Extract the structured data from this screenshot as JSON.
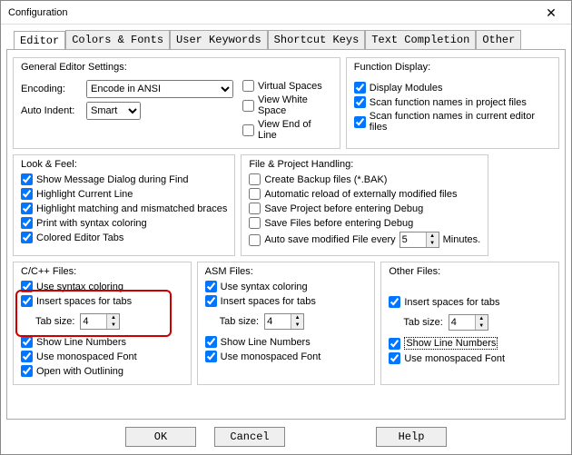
{
  "window": {
    "title": "Configuration"
  },
  "tabs": {
    "editor": "Editor",
    "colors": "Colors & Fonts",
    "keywords": "User Keywords",
    "shortcuts": "Shortcut Keys",
    "completion": "Text Completion",
    "other": "Other"
  },
  "general": {
    "title": "General Editor Settings:",
    "encoding_label": "Encoding:",
    "encoding_value": "Encode in ANSI",
    "autoindent_label": "Auto Indent:",
    "autoindent_value": "Smart",
    "virtual_spaces": "Virtual Spaces",
    "view_whitespace": "View White Space",
    "view_eol": "View End of Line"
  },
  "funcdisp": {
    "title": "Function Display:",
    "display_modules": "Display Modules",
    "scan_project": "Scan function names in project files",
    "scan_current": "Scan function names in current editor files"
  },
  "lookfeel": {
    "title": "Look & Feel:",
    "msg_dialog": "Show Message Dialog during Find",
    "hl_current": "Highlight Current Line",
    "hl_braces": "Highlight matching and mismatched braces",
    "print_syntax": "Print with syntax coloring",
    "colored_tabs": "Colored Editor Tabs"
  },
  "filehandling": {
    "title": "File & Project Handling:",
    "backup": "Create Backup files (*.BAK)",
    "autoreload": "Automatic reload of externally modified files",
    "save_proj_debug": "Save Project before entering Debug",
    "save_files_debug": "Save Files before entering Debug",
    "autosave": "Auto save modified File every",
    "autosave_minutes": "5",
    "minutes_label": "Minutes."
  },
  "cfiles": {
    "title": "C/C++ Files:",
    "syntax": "Use syntax coloring",
    "insert_spaces": "Insert spaces for tabs",
    "tabsize_label": "Tab size:",
    "tabsize_value": "4",
    "line_numbers": "Show Line Numbers",
    "mono_font": "Use monospaced Font",
    "outlining": "Open with Outlining"
  },
  "asmfiles": {
    "title": "ASM Files:",
    "syntax": "Use syntax coloring",
    "insert_spaces": "Insert spaces for tabs",
    "tabsize_label": "Tab size:",
    "tabsize_value": "4",
    "line_numbers": "Show Line Numbers",
    "mono_font": "Use monospaced Font"
  },
  "otherfiles": {
    "title": "Other Files:",
    "insert_spaces": "Insert spaces for tabs",
    "tabsize_label": "Tab size:",
    "tabsize_value": "4",
    "line_numbers": "Show Line Numbers",
    "mono_font": "Use monospaced Font"
  },
  "buttons": {
    "ok": "OK",
    "cancel": "Cancel",
    "help": "Help"
  }
}
